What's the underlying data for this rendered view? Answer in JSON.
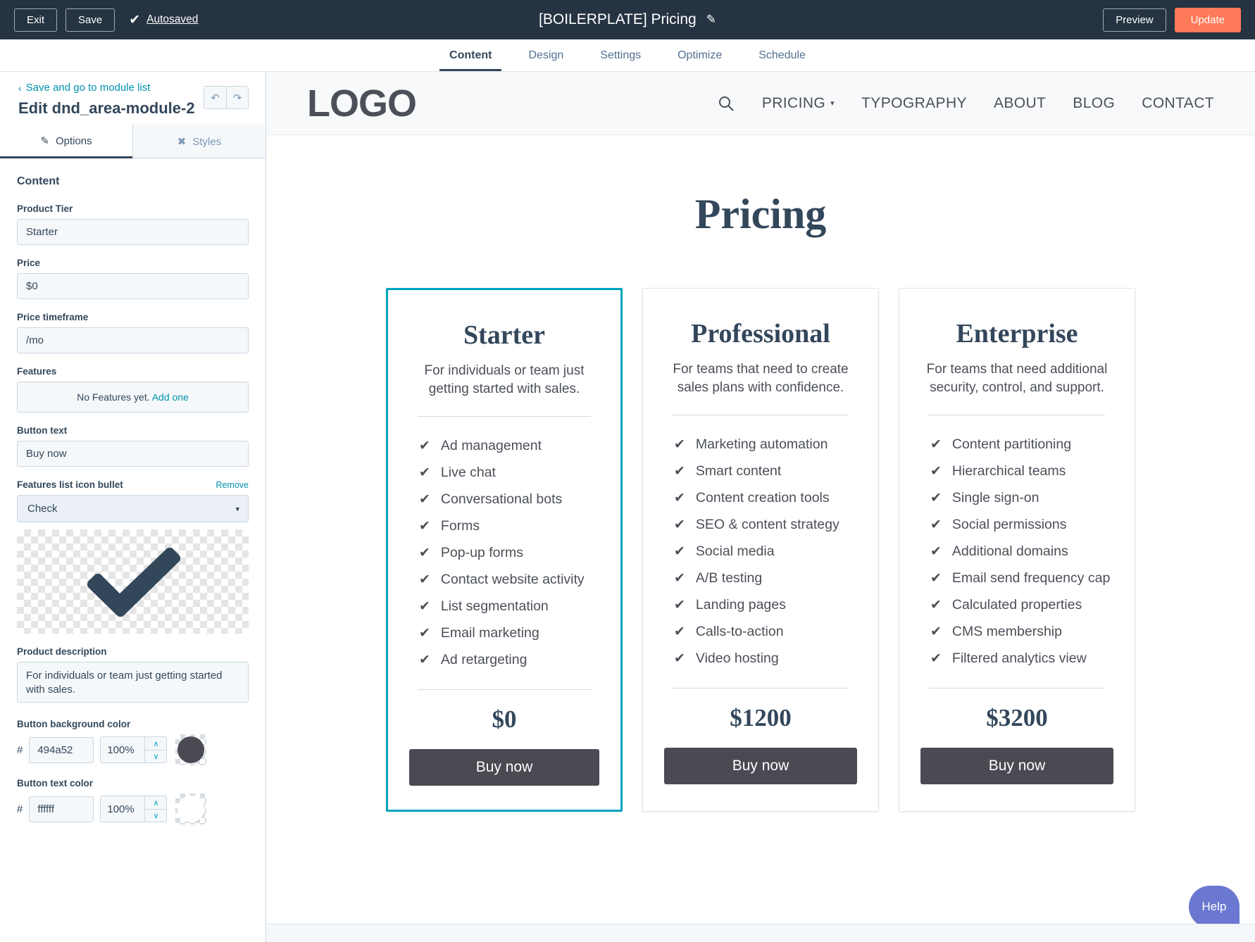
{
  "topbar": {
    "exit_label": "Exit",
    "save_label": "Save",
    "autosaved_label": "Autosaved",
    "check_glyph": "✔",
    "title": "[BOILERPLATE] Pricing",
    "pencil_glyph": "✎",
    "preview_label": "Preview",
    "update_label": "Update",
    "bar_color": "#253342",
    "update_color": "#ff7a59"
  },
  "nav_tabs": [
    {
      "label": "Content",
      "active": true
    },
    {
      "label": "Design",
      "active": false
    },
    {
      "label": "Settings",
      "active": false
    },
    {
      "label": "Optimize",
      "active": false
    },
    {
      "label": "Schedule",
      "active": false
    }
  ],
  "sidebar": {
    "back_link": "Save and go to module list",
    "back_chevron": "‹",
    "title": "Edit dnd_area-module-2",
    "undo_glyph": "↶",
    "redo_glyph": "↷",
    "tabs": {
      "options_label": "Options",
      "options_icon": "✎",
      "styles_label": "Styles",
      "styles_icon": "✖"
    },
    "section_title": "Content",
    "fields": {
      "product_tier_label": "Product Tier",
      "product_tier_value": "Starter",
      "price_label": "Price",
      "price_value": "$0",
      "price_timeframe_label": "Price timeframe",
      "price_timeframe_value": "/mo",
      "features_label": "Features",
      "features_empty_text": "No Features yet. ",
      "features_add_link": "Add one",
      "button_text_label": "Button text",
      "button_text_value": "Buy now",
      "icon_bullet_label": "Features list icon bullet",
      "icon_bullet_remove": "Remove",
      "icon_bullet_value": "Check",
      "icon_bullet_caret": "▾",
      "icon_preview_name": "check-mark-icon",
      "product_description_label": "Product description",
      "product_description_value": "For individuals or team just getting started with sales.",
      "button_bg_label": "Button background color",
      "button_bg_hex": "494a52",
      "button_bg_opacity": "100%",
      "button_text_color_label": "Button text color",
      "button_text_hex": "ffffff",
      "button_text_opacity": "100%",
      "hash": "#",
      "step_up": "∧",
      "step_down": "∨"
    }
  },
  "site": {
    "logo": "LOGO",
    "search_icon": "search-icon",
    "menu": [
      {
        "label": "PRICING",
        "has_caret": true
      },
      {
        "label": "TYPOGRAPHY",
        "has_caret": false
      },
      {
        "label": "ABOUT",
        "has_caret": false
      },
      {
        "label": "BLOG",
        "has_caret": false
      },
      {
        "label": "CONTACT",
        "has_caret": false
      }
    ],
    "caret_glyph": "▾",
    "page_title": "Pricing",
    "check_glyph": "✔",
    "cards": [
      {
        "title": "Starter",
        "description": "For individuals or team just getting started with sales.",
        "features": [
          "Ad management",
          "Live chat",
          "Conversational bots",
          "Forms",
          "Pop-up forms",
          "Contact website activity",
          "List segmentation",
          "Email marketing",
          "Ad retargeting"
        ],
        "price": "$0",
        "button_label": "Buy now",
        "selected": true
      },
      {
        "title": "Professional",
        "description": "For teams that need to create sales plans with confidence.",
        "features": [
          "Marketing automation",
          "Smart content",
          "Content creation tools",
          "SEO & content strategy",
          "Social media",
          "A/B testing",
          "Landing pages",
          "Calls-to-action",
          "Video hosting"
        ],
        "price": "$1200",
        "button_label": "Buy now",
        "selected": false
      },
      {
        "title": "Enterprise",
        "description": "For teams that need additional security, control, and support.",
        "features": [
          "Content partitioning",
          "Hierarchical teams",
          "Single sign-on",
          "Social permissions",
          "Additional domains",
          "Email send frequency cap",
          "Calculated properties",
          "CMS membership",
          "Filtered analytics view"
        ],
        "price": "$3200",
        "button_label": "Buy now",
        "selected": false
      }
    ],
    "button_bg_color": "#494a52",
    "button_text_color": "#ffffff",
    "selected_border_color": "#00a4bd"
  },
  "help": {
    "label": "Help",
    "color": "#6a78d1"
  }
}
